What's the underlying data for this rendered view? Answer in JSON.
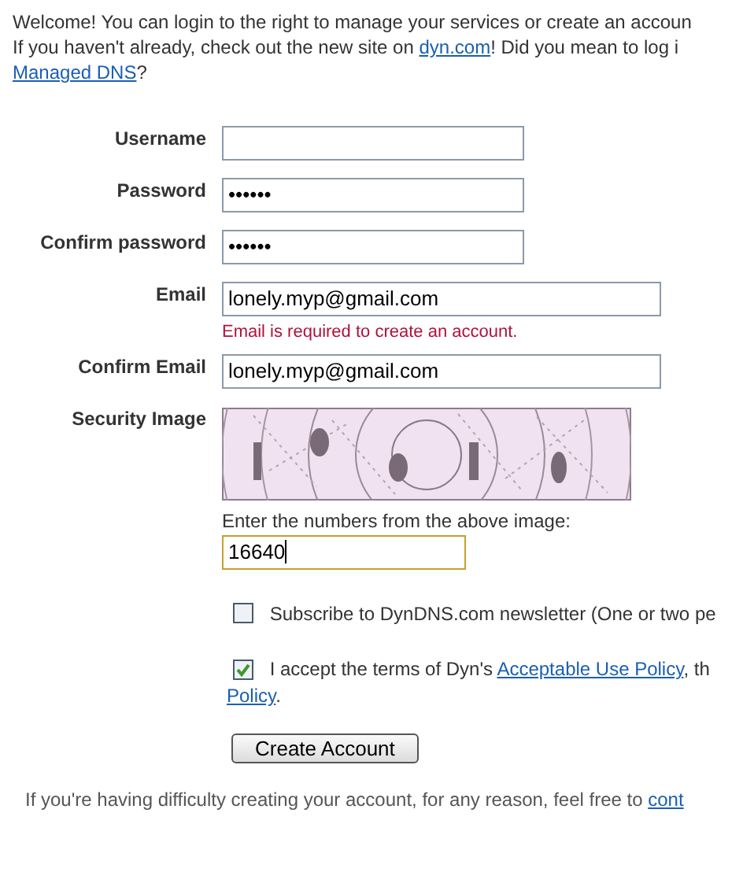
{
  "intro": [
    [
      {
        "text": "Welcome! You can login to the right to manage your services or create an accoun"
      }
    ],
    [
      {
        "text": "If you haven't already, check out the new site on "
      },
      {
        "link": "dyn.com"
      },
      {
        "text": "! Did you mean to log i"
      }
    ],
    [
      {
        "link": "Managed DNS"
      },
      {
        "text": "?"
      }
    ]
  ],
  "fields": [
    {
      "label": "Username",
      "kind": "text"
    },
    {
      "label": "Password",
      "kind": "password",
      "value": "••••••"
    },
    {
      "label": "Confirm password",
      "kind": "password",
      "value": "••••••"
    },
    {
      "label": "Email",
      "kind": "email",
      "value": "lonely.myp@gmail.com",
      "error": "Email is required to create an account."
    },
    {
      "label": "Confirm Email",
      "kind": "email",
      "value": "lonely.myp@gmail.com"
    }
  ],
  "captcha": {
    "label": "Security Image",
    "prompt": "Enter the numbers from the above image:",
    "value": "16640",
    "focused": true
  },
  "checkboxes": [
    {
      "checked": false,
      "lines": [
        [
          {
            "text": "Subscribe to DynDNS.com newsletter (One or two pe"
          }
        ]
      ]
    },
    {
      "checked": true,
      "lines": [
        [
          {
            "text": "I accept the terms of Dyn's "
          },
          {
            "link": "Acceptable Use Policy"
          },
          {
            "text": ", th"
          }
        ],
        [
          {
            "link": "Policy"
          },
          {
            "text": "."
          }
        ]
      ]
    }
  ],
  "button": "Create Account",
  "footer": [
    {
      "text": "If you're having difficulty creating your account, for any reason, feel free to "
    },
    {
      "link": "cont"
    }
  ]
}
